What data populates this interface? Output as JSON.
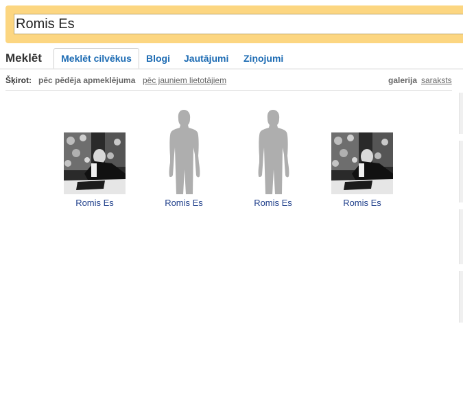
{
  "search": {
    "value": "Romis Es"
  },
  "tabs": {
    "title": "Meklēt",
    "items": [
      {
        "label": "Meklēt cilvēkus"
      },
      {
        "label": "Blogi"
      },
      {
        "label": "Jautājumi"
      },
      {
        "label": "Ziņojumi"
      }
    ]
  },
  "sort": {
    "label": "Šķirot:",
    "option_last_visit": "pēc pēdēja apmeklējuma",
    "option_new_users": "pēc jauniem lietotājiem",
    "view_gallery": "galerija",
    "view_list": "saraksts"
  },
  "results": [
    {
      "name": "Romis Es",
      "avatar": "photo"
    },
    {
      "name": "Romis Es",
      "avatar": "silhouette"
    },
    {
      "name": "Romis Es",
      "avatar": "silhouette"
    },
    {
      "name": "Romis Es",
      "avatar": "photo"
    }
  ],
  "colors": {
    "search_bar_bg": "#fcd681",
    "tab_link": "#1c6bb3",
    "result_name": "#1f3f8b",
    "silhouette": "#aeaeae"
  }
}
